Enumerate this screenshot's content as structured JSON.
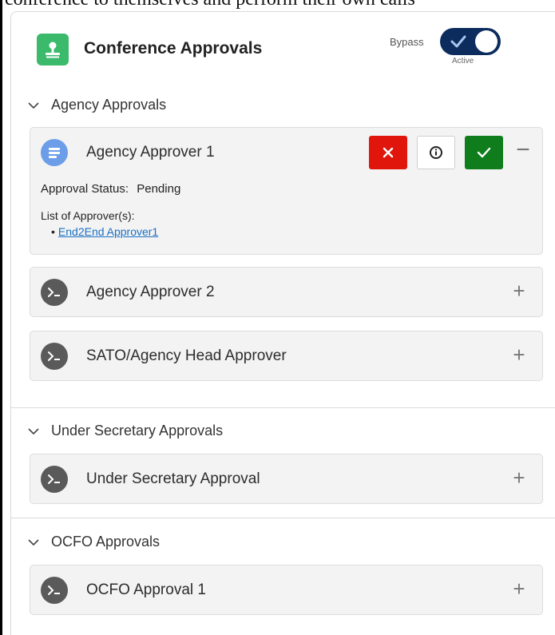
{
  "page_top_text": "conference to themselves and perform their own calls",
  "header": {
    "title": "Conference Approvals",
    "bypass_label": "Bypass",
    "toggle_state_label": "Active",
    "icon": "user-approval-icon",
    "accent_color": "#3bba6c",
    "toggle_color": "#0b2c5c"
  },
  "sections": [
    {
      "title": "Agency Approvals",
      "approvers": [
        {
          "name": "Agency Approver 1",
          "expanded": true,
          "status_label": "Approval Status:",
          "status_value": "Pending",
          "list_label": "List of Approver(s):",
          "approvers_list": [
            "End2End Approver1"
          ]
        },
        {
          "name": "Agency Approver 2",
          "expanded": false
        },
        {
          "name": "SATO/Agency Head Approver",
          "expanded": false
        }
      ]
    },
    {
      "title": "Under Secretary Approvals",
      "approvers": [
        {
          "name": "Under Secretary Approval",
          "expanded": false
        }
      ]
    },
    {
      "title": "OCFO Approvals",
      "approvers": [
        {
          "name": "OCFO Approval 1",
          "expanded": false
        }
      ]
    }
  ],
  "colors": {
    "reject": "#e0160d",
    "approve": "#0f7d1c",
    "link": "#1a6fc4"
  }
}
